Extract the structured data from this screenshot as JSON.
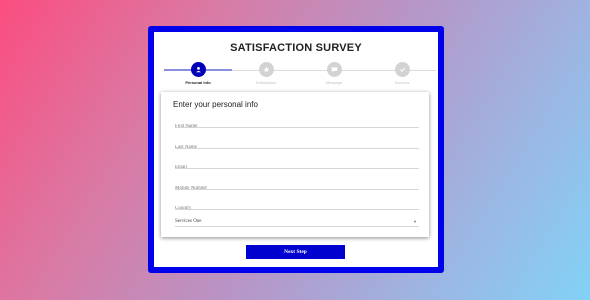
{
  "survey": {
    "title": "SATISFACTION SURVEY",
    "progress_fraction": 0.25,
    "steps": [
      {
        "label": "Personal Info",
        "icon": "user-icon",
        "active": true
      },
      {
        "label": "Satisfaction",
        "icon": "star-icon",
        "active": false
      },
      {
        "label": "Message",
        "icon": "chat-icon",
        "active": false
      },
      {
        "label": "Success",
        "icon": "check-icon",
        "active": false
      }
    ]
  },
  "form": {
    "heading": "Enter your personal info",
    "first_name_placeholder": "First Name",
    "last_name_placeholder": "Last Name",
    "email_placeholder": "Email",
    "mobile_placeholder": "Mobile Number",
    "country_placeholder": "Country",
    "services_selected": "Services One"
  },
  "buttons": {
    "next_label": "Next Step"
  },
  "colors": {
    "frame_border": "#0000ea",
    "active_step": "#0000b8",
    "button": "#0000cf",
    "gradient_start": "#fb4d80",
    "gradient_end": "#82d2f7"
  }
}
